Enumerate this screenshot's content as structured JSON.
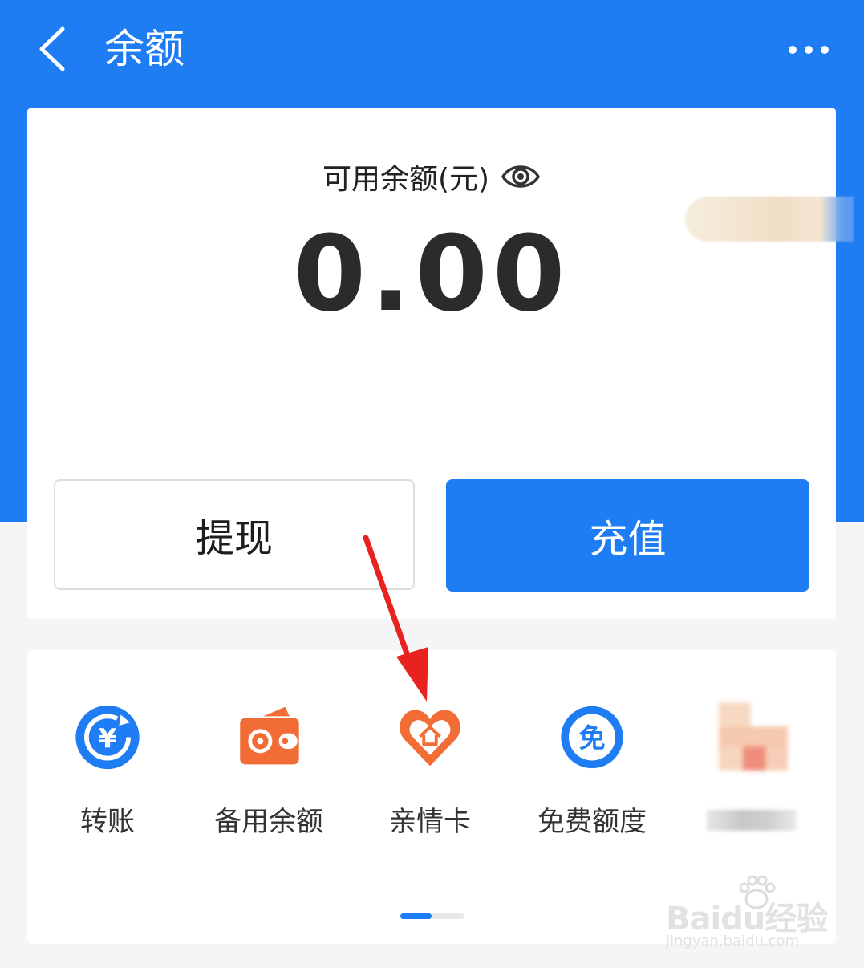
{
  "header": {
    "title": "余额",
    "back_icon": "chevron-left-icon",
    "more_icon": "more-horizontal-icon"
  },
  "balance": {
    "label": "可用余额(元)",
    "amount": "0.00",
    "eye_icon": "eye-icon"
  },
  "actions": {
    "withdraw_label": "提现",
    "recharge_label": "充值"
  },
  "services": [
    {
      "label": "转账",
      "icon": "transfer-yuan-icon"
    },
    {
      "label": "备用余额",
      "icon": "wallet-icon"
    },
    {
      "label": "亲情卡",
      "icon": "family-card-heart-icon"
    },
    {
      "label": "免费额度",
      "icon": "free-quota-icon"
    }
  ],
  "pager": {
    "pages": 2,
    "current": 1
  },
  "watermark": {
    "main": "Baidu经验",
    "sub": "jingyan.baidu.com"
  },
  "colors": {
    "primary": "#1e7df3",
    "background": "#f5f5f7",
    "icon_orange": "#f26d35",
    "arrow_red": "#e8231f"
  }
}
